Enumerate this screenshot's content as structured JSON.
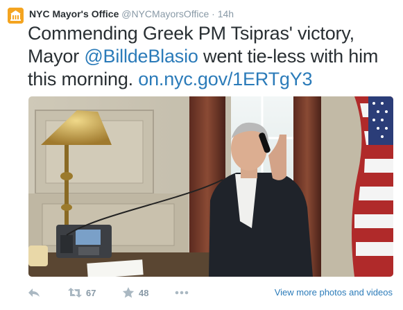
{
  "tweet": {
    "author_name": "NYC Mayor's Office",
    "author_handle": "@NYCMayorsOffice",
    "separator": "·",
    "time": "14h",
    "text_prefix": "Commending Greek PM Tsipras' victory, Mayor ",
    "mention": "@BilldeBlasio",
    "text_middle": " went tie-less with him this morning. ",
    "link": "on.nyc.gov/1ERTgY3"
  },
  "actions": {
    "retweet_count": "67",
    "favorite_count": "48",
    "view_more_label": "View more photos and videos"
  },
  "colors": {
    "accent": "#2b7bb9",
    "muted": "#8899a6",
    "text": "#292f33",
    "avatar_bg": "#f4a420"
  },
  "icons": [
    "nyc-seal-icon",
    "reply-icon",
    "retweet-icon",
    "favorite-star-icon",
    "more-dots-icon"
  ]
}
